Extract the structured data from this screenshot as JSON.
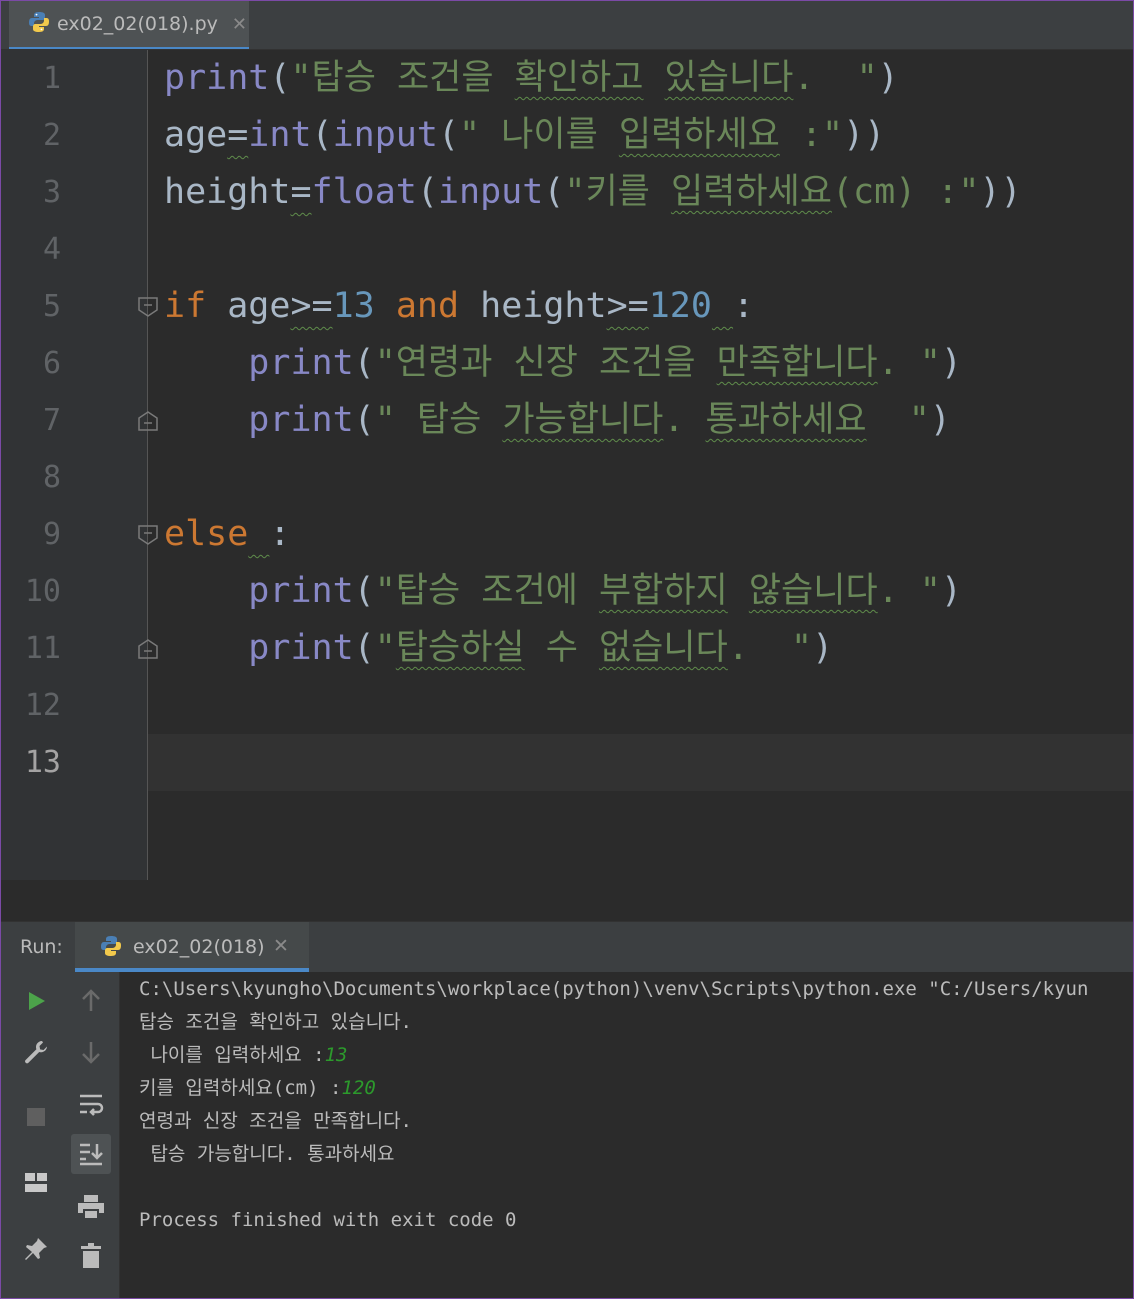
{
  "file_tab": {
    "label": "ex02_02(018).py",
    "icon": "python-file-icon"
  },
  "editor": {
    "line_numbers": [
      "1",
      "2",
      "3",
      "4",
      "5",
      "6",
      "7",
      "8",
      "9",
      "10",
      "11",
      "12",
      "13"
    ],
    "current_line": "13",
    "lines": [
      {
        "line": 1,
        "tokens": [
          {
            "t": "print",
            "c": "fn"
          },
          {
            "t": "(",
            "c": "p"
          },
          {
            "t": "\"탑승 조건을 ",
            "c": "str"
          },
          {
            "t": "확인하고",
            "c": "str sq"
          },
          {
            "t": " ",
            "c": "str"
          },
          {
            "t": "있습니다",
            "c": "str sq"
          },
          {
            "t": ".  \"",
            "c": "str"
          },
          {
            "t": ")",
            "c": "p"
          }
        ]
      },
      {
        "line": 2,
        "tokens": [
          {
            "t": "age",
            "c": "p"
          },
          {
            "t": "=",
            "c": "p sq-op"
          },
          {
            "t": "int",
            "c": "fn"
          },
          {
            "t": "(",
            "c": "p"
          },
          {
            "t": "input",
            "c": "fn"
          },
          {
            "t": "(",
            "c": "p"
          },
          {
            "t": "\" 나이를 ",
            "c": "str"
          },
          {
            "t": "입력하세요",
            "c": "str sq"
          },
          {
            "t": " :\"",
            "c": "str"
          },
          {
            "t": "))",
            "c": "p"
          }
        ]
      },
      {
        "line": 3,
        "tokens": [
          {
            "t": "height",
            "c": "p"
          },
          {
            "t": "=",
            "c": "p sq-op"
          },
          {
            "t": "float",
            "c": "fn"
          },
          {
            "t": "(",
            "c": "p"
          },
          {
            "t": "input",
            "c": "fn"
          },
          {
            "t": "(",
            "c": "p"
          },
          {
            "t": "\"키를 ",
            "c": "str"
          },
          {
            "t": "입력하세요",
            "c": "str sq"
          },
          {
            "t": "(cm) :\"",
            "c": "str"
          },
          {
            "t": "))",
            "c": "p"
          }
        ]
      },
      {
        "line": 4,
        "tokens": []
      },
      {
        "line": 5,
        "tokens": [
          {
            "t": "if",
            "c": "kw"
          },
          {
            "t": " age",
            "c": "p"
          },
          {
            "t": ">=",
            "c": "p sq-op"
          },
          {
            "t": "13",
            "c": "num"
          },
          {
            "t": " ",
            "c": "p"
          },
          {
            "t": "and",
            "c": "kw"
          },
          {
            "t": " height",
            "c": "p"
          },
          {
            "t": ">=",
            "c": "p sq-op"
          },
          {
            "t": "120",
            "c": "num"
          },
          {
            "t": " ",
            "c": "p sq-op"
          },
          {
            "t": ":",
            "c": "p"
          }
        ]
      },
      {
        "line": 6,
        "tokens": [
          {
            "t": "    ",
            "c": "p"
          },
          {
            "t": "print",
            "c": "fn"
          },
          {
            "t": "(",
            "c": "p"
          },
          {
            "t": "\"연령과 신장 조건을 ",
            "c": "str"
          },
          {
            "t": "만족합니다",
            "c": "str sq"
          },
          {
            "t": ". \"",
            "c": "str"
          },
          {
            "t": ")",
            "c": "p"
          }
        ]
      },
      {
        "line": 7,
        "tokens": [
          {
            "t": "    ",
            "c": "p"
          },
          {
            "t": "print",
            "c": "fn"
          },
          {
            "t": "(",
            "c": "p"
          },
          {
            "t": "\" 탑승 ",
            "c": "str"
          },
          {
            "t": "가능합니다",
            "c": "str sq"
          },
          {
            "t": ". ",
            "c": "str"
          },
          {
            "t": "통과하세요",
            "c": "str sq"
          },
          {
            "t": "  \"",
            "c": "str"
          },
          {
            "t": ")",
            "c": "p"
          }
        ]
      },
      {
        "line": 8,
        "tokens": []
      },
      {
        "line": 9,
        "tokens": [
          {
            "t": "else",
            "c": "kw"
          },
          {
            "t": " ",
            "c": "p sq-op"
          },
          {
            "t": ":",
            "c": "p"
          }
        ]
      },
      {
        "line": 10,
        "tokens": [
          {
            "t": "    ",
            "c": "p"
          },
          {
            "t": "print",
            "c": "fn"
          },
          {
            "t": "(",
            "c": "p"
          },
          {
            "t": "\"탑승 조건에 ",
            "c": "str"
          },
          {
            "t": "부합하지",
            "c": "str sq"
          },
          {
            "t": " ",
            "c": "str"
          },
          {
            "t": "않습니다",
            "c": "str sq"
          },
          {
            "t": ". \"",
            "c": "str"
          },
          {
            "t": ")",
            "c": "p"
          }
        ]
      },
      {
        "line": 11,
        "tokens": [
          {
            "t": "    ",
            "c": "p"
          },
          {
            "t": "print",
            "c": "fn"
          },
          {
            "t": "(",
            "c": "p"
          },
          {
            "t": "\"",
            "c": "str"
          },
          {
            "t": "탑승하실",
            "c": "str sq"
          },
          {
            "t": " 수 ",
            "c": "str"
          },
          {
            "t": "없습니다",
            "c": "str sq"
          },
          {
            "t": ".  \"",
            "c": "str"
          },
          {
            "t": ")",
            "c": "p"
          }
        ]
      },
      {
        "line": 12,
        "tokens": []
      },
      {
        "line": 13,
        "tokens": []
      }
    ]
  },
  "run_panel": {
    "label": "Run:",
    "tab_label": "ex02_02(018)",
    "console": [
      {
        "text": "C:\\Users\\kyungho\\Documents\\workplace(python)\\venv\\Scripts\\python.exe \"C:/Users/kyun",
        "input": ""
      },
      {
        "text": "탑승 조건을 확인하고 있습니다.",
        "input": ""
      },
      {
        "text": " 나이를 입력하세요 :",
        "input": "13"
      },
      {
        "text": "키를 입력하세요(cm) :",
        "input": "120"
      },
      {
        "text": "연령과 신장 조건을 만족합니다.",
        "input": ""
      },
      {
        "text": " 탑승 가능합니다. 통과하세요",
        "input": ""
      },
      {
        "text": "",
        "input": ""
      },
      {
        "text": "Process finished with exit code 0",
        "input": ""
      }
    ],
    "toolbar_left": [
      "run-icon",
      "wrench-icon",
      "stop-icon",
      "layout-icon",
      "pin-icon"
    ],
    "toolbar_right": [
      "up-arrow-icon",
      "down-arrow-icon",
      "soft-wrap-icon",
      "scroll-to-end-icon",
      "print-icon",
      "trash-icon"
    ]
  },
  "colors": {
    "keyword": "#cc7832",
    "builtin": "#8888c6",
    "string": "#6a8759",
    "number": "#6897bb",
    "default": "#a9b7c6",
    "user_input": "#2c9a2c",
    "run_icon": "#4ca34a",
    "accent": "#4a88c7"
  }
}
